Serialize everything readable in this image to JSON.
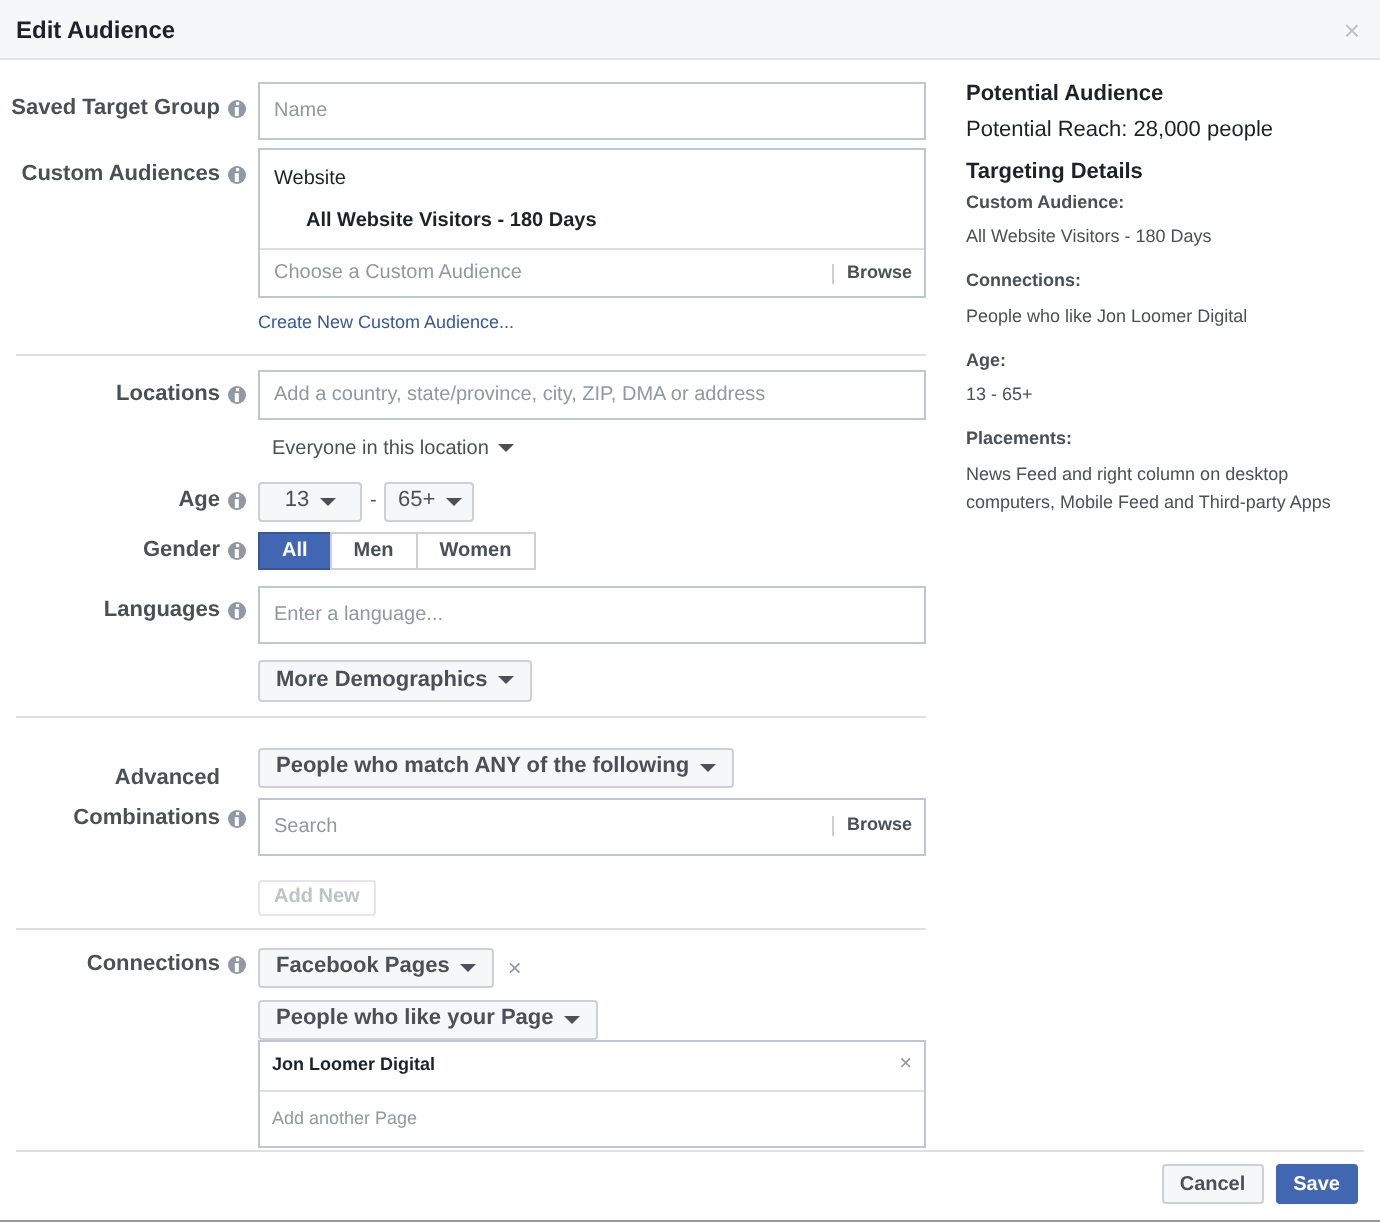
{
  "window": {
    "title": "Edit Audience",
    "close": "×"
  },
  "saved_target_group": {
    "label": "Saved Target Group",
    "placeholder": "Name"
  },
  "custom_audiences": {
    "label": "Custom Audiences",
    "group": "Website",
    "item": "All Website Visitors - 180 Days",
    "placeholder": "Choose a Custom Audience",
    "browse": "Browse",
    "link": "Create New Custom Audience..."
  },
  "locations": {
    "label": "Locations",
    "placeholder": "Add a country, state/province, city, ZIP, DMA or address",
    "dropdown": "Everyone in this location"
  },
  "age": {
    "label": "Age",
    "min": "13",
    "separator": "-",
    "max": "65+"
  },
  "gender": {
    "label": "Gender",
    "options": [
      {
        "label": "All",
        "selected": true
      },
      {
        "label": "Men",
        "selected": false
      },
      {
        "label": "Women",
        "selected": false
      }
    ]
  },
  "languages": {
    "label": "Languages",
    "placeholder": "Enter a language..."
  },
  "more_demographics": "More Demographics",
  "advanced_combinations": {
    "label_line1": "Advanced",
    "label_line2": "Combinations",
    "dropdown": "People who match ANY of the following",
    "placeholder": "Search",
    "browse": "Browse",
    "add_new": {
      "label": "Add New",
      "disabled": true
    }
  },
  "connections": {
    "label": "Connections",
    "type_dropdown": "Facebook Pages",
    "remove": "×",
    "filter_dropdown": "People who like your Page",
    "page": "Jon Loomer Digital",
    "page_remove": "×",
    "placeholder": "Add another Page"
  },
  "buttons": [
    {
      "label": "Cancel",
      "kind": "secondary"
    },
    {
      "label": "Save",
      "kind": "primary"
    }
  ],
  "summary": {
    "title": "Potential Audience",
    "reach": "Potential Reach: 28,000 people",
    "details_title": "Targeting Details",
    "details": [
      {
        "heading": "Custom Audience:",
        "text": "All Website Visitors - 180 Days"
      },
      {
        "heading": "Connections:",
        "text": "People who like Jon Loomer Digital"
      },
      {
        "heading": "Age:",
        "text": "13 - 65+"
      },
      {
        "heading": "Placements:",
        "text": "News Feed and right column on desktop computers, Mobile Feed and Third-party Apps"
      }
    ]
  }
}
